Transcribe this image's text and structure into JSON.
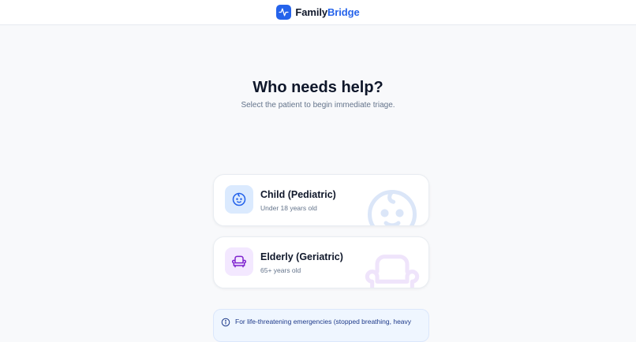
{
  "header": {
    "brand_part1": "Family",
    "brand_part2": "Bridge",
    "logo_icon": "pulse-icon",
    "accent": "#2563eb"
  },
  "main": {
    "title": "Who needs help?",
    "subtitle": "Select the patient to begin immediate triage."
  },
  "cards": [
    {
      "title": "Child (Pediatric)",
      "desc": "Under 18 years old",
      "icon": "baby-face-icon",
      "icon_bg": "#dbeafe",
      "icon_color": "#2563eb"
    },
    {
      "title": "Elderly (Geriatric)",
      "desc": "65+ years old",
      "icon": "armchair-icon",
      "icon_bg": "#f3e8ff",
      "icon_color": "#7e22ce"
    }
  ],
  "notice": {
    "text": "For life-threatening emergencies (stopped breathing, heavy",
    "icon": "info-icon"
  }
}
